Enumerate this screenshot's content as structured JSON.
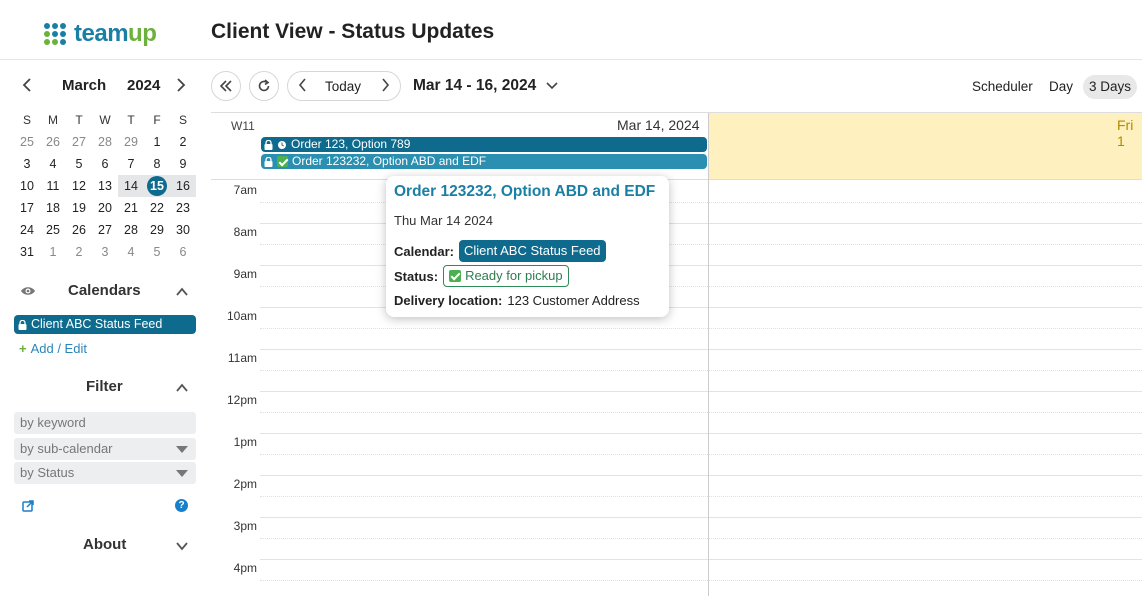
{
  "header": {
    "logo_text_a": "team",
    "logo_text_b": "up",
    "page_title": "Client View - Status Updates"
  },
  "mini_calendar": {
    "month": "March",
    "year": "2024",
    "weekdays": [
      "S",
      "M",
      "T",
      "W",
      "T",
      "F",
      "S"
    ],
    "weeks": [
      [
        "25",
        "26",
        "27",
        "28",
        "29",
        "1",
        "2"
      ],
      [
        "3",
        "4",
        "5",
        "6",
        "7",
        "8",
        "9"
      ],
      [
        "10",
        "11",
        "12",
        "13",
        "14",
        "15",
        "16"
      ],
      [
        "17",
        "18",
        "19",
        "20",
        "21",
        "22",
        "23"
      ],
      [
        "24",
        "25",
        "26",
        "27",
        "28",
        "29",
        "30"
      ],
      [
        "31",
        "1",
        "2",
        "3",
        "4",
        "5",
        "6"
      ]
    ]
  },
  "sidebar": {
    "calendars_title": "Calendars",
    "calendar_item": "Client ABC Status Feed",
    "add_edit": "Add / Edit",
    "filter_title": "Filter",
    "filter_keyword_placeholder": "by keyword",
    "filter_subcalendar": "by sub-calendar",
    "filter_status": "by Status",
    "about_title": "About"
  },
  "toolbar": {
    "today_label": "Today",
    "date_range": "Mar 14 - 16, 2024",
    "views": [
      "Scheduler",
      "Day",
      "3 Days"
    ],
    "active_view": "3 Days"
  },
  "calendar": {
    "week_label": "W11",
    "day_header": "Mar 14, 2024",
    "next_day_header": "Fri 1",
    "hours": [
      "7am",
      "8am",
      "9am",
      "10am",
      "11am",
      "12pm",
      "1pm",
      "2pm",
      "3pm",
      "4pm"
    ],
    "events": [
      {
        "title": "Order 123, Option 789",
        "color": "#0f6b8e"
      },
      {
        "title": "Order 123232, Option ABD and EDF",
        "color": "#2a8fb0"
      }
    ]
  },
  "popover": {
    "title": "Order 123232, Option ABD and EDF",
    "date": "Thu Mar 14 2024",
    "calendar_label": "Calendar:",
    "calendar_value": "Client ABC Status Feed",
    "status_label": "Status:",
    "status_value": "Ready for pickup",
    "location_label": "Delivery location:",
    "location_value": "123 Customer Address"
  }
}
